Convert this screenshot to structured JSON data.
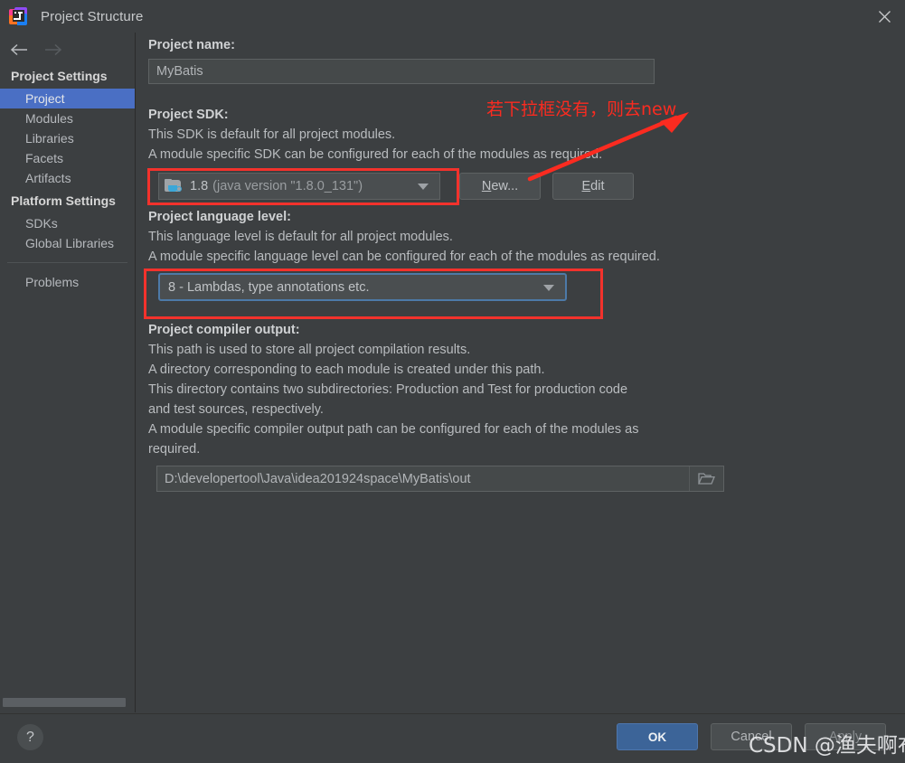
{
  "window": {
    "title": "Project Structure",
    "app_icon": "intellij-idea-icon",
    "close_icon": "close-icon"
  },
  "sidebar": {
    "back_icon": "arrow-left-icon",
    "forward_icon": "arrow-right-icon",
    "groups": [
      {
        "label": "Project Settings",
        "items": [
          {
            "label": "Project",
            "selected": true
          },
          {
            "label": "Modules",
            "selected": false
          },
          {
            "label": "Libraries",
            "selected": false
          },
          {
            "label": "Facets",
            "selected": false
          },
          {
            "label": "Artifacts",
            "selected": false
          }
        ]
      },
      {
        "label": "Platform Settings",
        "items": [
          {
            "label": "SDKs",
            "selected": false
          },
          {
            "label": "Global Libraries",
            "selected": false
          }
        ]
      }
    ],
    "extra_items": [
      {
        "label": "Problems",
        "selected": false
      }
    ]
  },
  "main": {
    "project_name": {
      "label": "Project name:",
      "value": "MyBatis"
    },
    "project_sdk": {
      "label": "Project SDK:",
      "desc_line1": "This SDK is default for all project modules.",
      "desc_line2": "A module specific SDK can be configured for each of the modules as required.",
      "selected": "1.8",
      "selected_detail": "(java version \"1.8.0_131\")",
      "sdk_icon": "java-sdk-folder-icon",
      "new_button": "New...",
      "new_button_mnemonic": "N",
      "edit_button": "Edit",
      "edit_button_mnemonic": "E"
    },
    "language_level": {
      "label": "Project language level:",
      "desc_line1": "This language level is default for all project modules.",
      "desc_line2": "A module specific language level can be configured for each of the modules as required.",
      "selected": "8 - Lambdas, type annotations etc."
    },
    "compiler_output": {
      "label": "Project compiler output:",
      "desc_line1": "This path is used to store all project compilation results.",
      "desc_line2": "A directory corresponding to each module is created under this path.",
      "desc_line3": "This directory contains two subdirectories: Production and Test for production code",
      "desc_line4": "and test sources, respectively.",
      "desc_line5": "A module specific compiler output path can be configured for each of the modules as",
      "desc_line6": "required.",
      "value": "D:\\developertool\\Java\\idea201924space\\MyBatis\\out",
      "browse_icon": "folder-browse-icon"
    }
  },
  "annotation": {
    "text": "若下拉框没有，则去new",
    "color": "#fb2b20",
    "arrow_icon": "red-arrow-icon"
  },
  "footer": {
    "help_label": "?",
    "ok_button": "OK",
    "cancel_button": "Cancel",
    "apply_button": "Apply"
  },
  "watermark": {
    "text": "CSDN @渔夫啊布"
  },
  "colors": {
    "background": "#3c3f41",
    "selection_blue": "#4a6fc4",
    "ok_button_blue": "#3c6498",
    "annotation_red": "#f3322c",
    "focus_border": "#4d7aa8"
  }
}
